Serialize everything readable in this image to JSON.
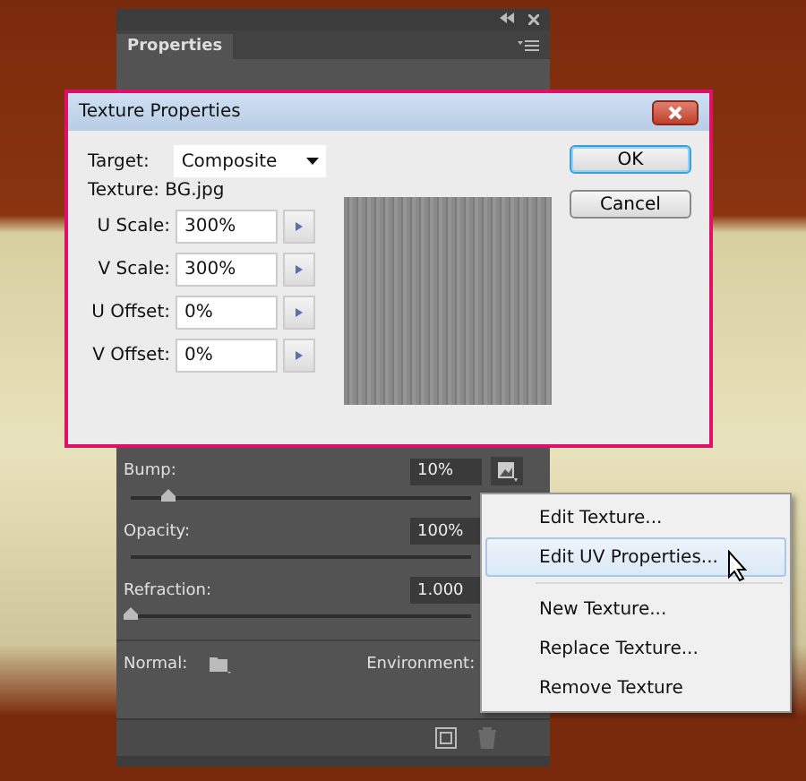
{
  "panel": {
    "tab": "Properties",
    "sliders": [
      {
        "label": "Bump:",
        "value": "10%",
        "level": 0.11
      },
      {
        "label": "Opacity:",
        "value": "100%"
      },
      {
        "label": "Refraction:",
        "value": "1.000",
        "level": 0
      }
    ],
    "normal_label": "Normal:",
    "environment_label": "Environment:"
  },
  "dialog": {
    "title": "Texture Properties",
    "target_label": "Target:",
    "target_value": "Composite",
    "texture": "Texture: BG.jpg",
    "fields": [
      {
        "label": "U Scale:",
        "value": "300%"
      },
      {
        "label": "V Scale:",
        "value": "300%"
      },
      {
        "label": "U Offset:",
        "value": "0%"
      },
      {
        "label": "V Offset:",
        "value": "0%"
      }
    ],
    "buttons": [
      "OK",
      "Cancel"
    ]
  },
  "menu": [
    {
      "label": "Edit Texture...",
      "selected": false
    },
    {
      "label": "Edit UV Properties...",
      "selected": true
    },
    {
      "label": "New Texture...",
      "selected": false,
      "separator_before": true
    },
    {
      "label": "Replace Texture...",
      "selected": false
    },
    {
      "label": "Remove Texture",
      "selected": false
    }
  ]
}
